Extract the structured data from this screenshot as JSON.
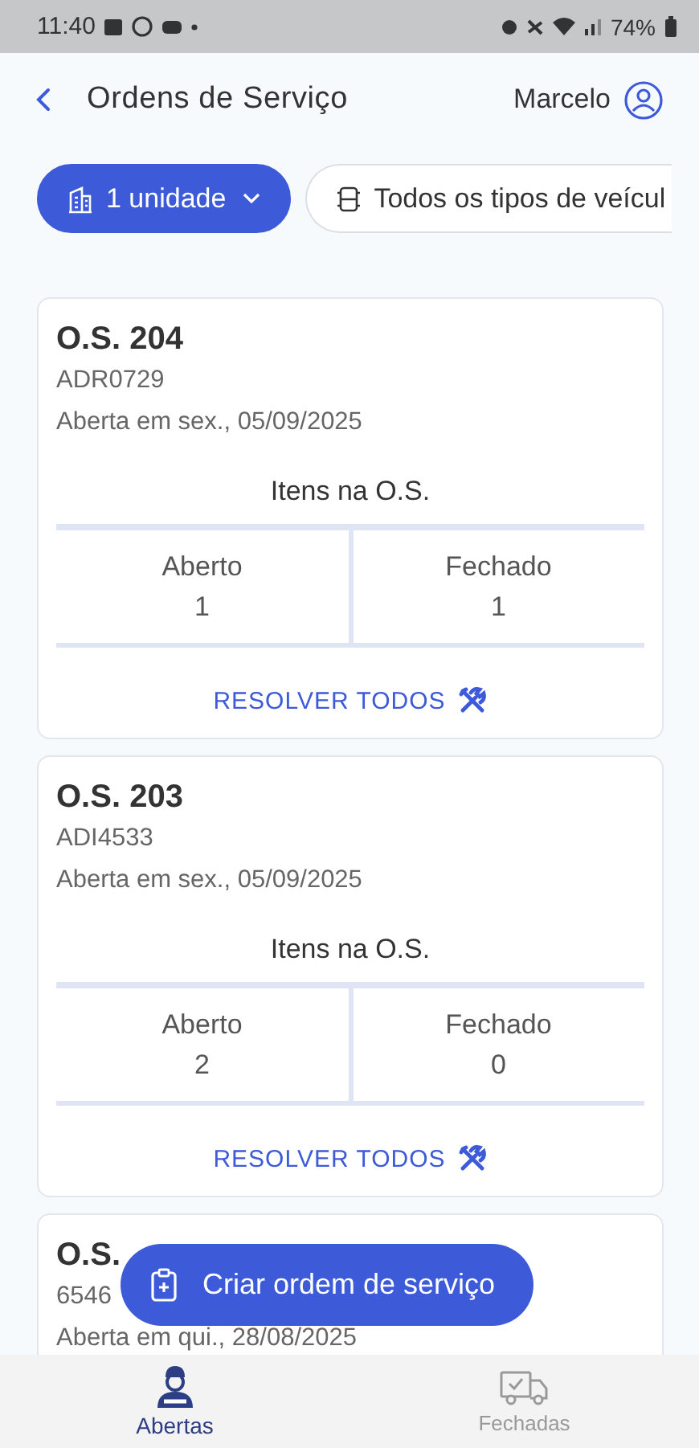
{
  "status_bar": {
    "time": "11:40",
    "battery": "74%"
  },
  "header": {
    "title": "Ordens de Serviço",
    "user": "Marcelo"
  },
  "filters": [
    {
      "label": "1 unidade",
      "selected": true,
      "kind": "unit"
    },
    {
      "label": "Todos os tipos de veícul",
      "selected": false,
      "kind": "vehicle"
    }
  ],
  "orders": [
    {
      "title": "O.S. 204",
      "plate": "ADR0729",
      "opened": "Aberta em sex., 05/09/2025",
      "items_heading": "Itens na O.S.",
      "columns": [
        {
          "label": "Aberto",
          "value": "1"
        },
        {
          "label": "Fechado",
          "value": "1"
        }
      ],
      "action": "RESOLVER TODOS"
    },
    {
      "title": "O.S. 203",
      "plate": "ADI4533",
      "opened": "Aberta em sex., 05/09/2025",
      "items_heading": "Itens na O.S.",
      "columns": [
        {
          "label": "Aberto",
          "value": "2"
        },
        {
          "label": "Fechado",
          "value": "0"
        }
      ],
      "action": "RESOLVER TODOS"
    },
    {
      "title": "O.S.",
      "plate": "6546",
      "opened": "Aberta em qui., 28/08/2025"
    }
  ],
  "fab": {
    "label": "Criar ordem de serviço"
  },
  "bottom_nav": [
    {
      "label": "Abertas",
      "selected": true,
      "kind": "mechanic"
    },
    {
      "label": "Fechadas",
      "selected": false,
      "kind": "truck"
    }
  ]
}
